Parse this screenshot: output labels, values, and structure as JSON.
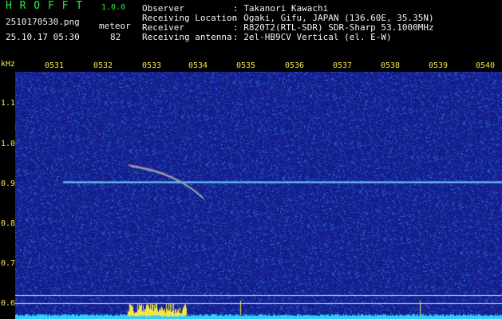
{
  "app": {
    "title": "H R O F F T",
    "version": "1.0.0"
  },
  "file": {
    "name": "2510170530.png",
    "datetime": "25.10.17 05:30"
  },
  "count": {
    "label": "meteor",
    "value": "82"
  },
  "info": [
    {
      "key": "Observer",
      "value": ": Takanori Kawachi"
    },
    {
      "key": "Receiving Location",
      "value": ": Ogaki, Gifu, JAPAN (136.60E, 35.35N)"
    },
    {
      "key": "Receiver",
      "value": ": R820T2(RTL-SDR) SDR-Sharp 53.1000MHz"
    },
    {
      "key": "Receiving antenna",
      "value": ": 2el-HB9CV Vertical (el. E-W)"
    }
  ],
  "axis": {
    "unit": "kHz",
    "x_ticks": [
      "0531",
      "0532",
      "0533",
      "0534",
      "0535",
      "0536",
      "0537",
      "0538",
      "0539",
      "0540"
    ],
    "y_ticks": [
      "1.1",
      "1.0",
      "0.9",
      "0.8",
      "0.7",
      "0.6"
    ]
  },
  "colors": {
    "background": "#000000",
    "spectrogram": "#1a2a8c",
    "carrier": "#6fd3ff",
    "label": "#f4e64a",
    "signal_bar": "#f4e64a",
    "base_bar": "#2fd0ff"
  }
}
